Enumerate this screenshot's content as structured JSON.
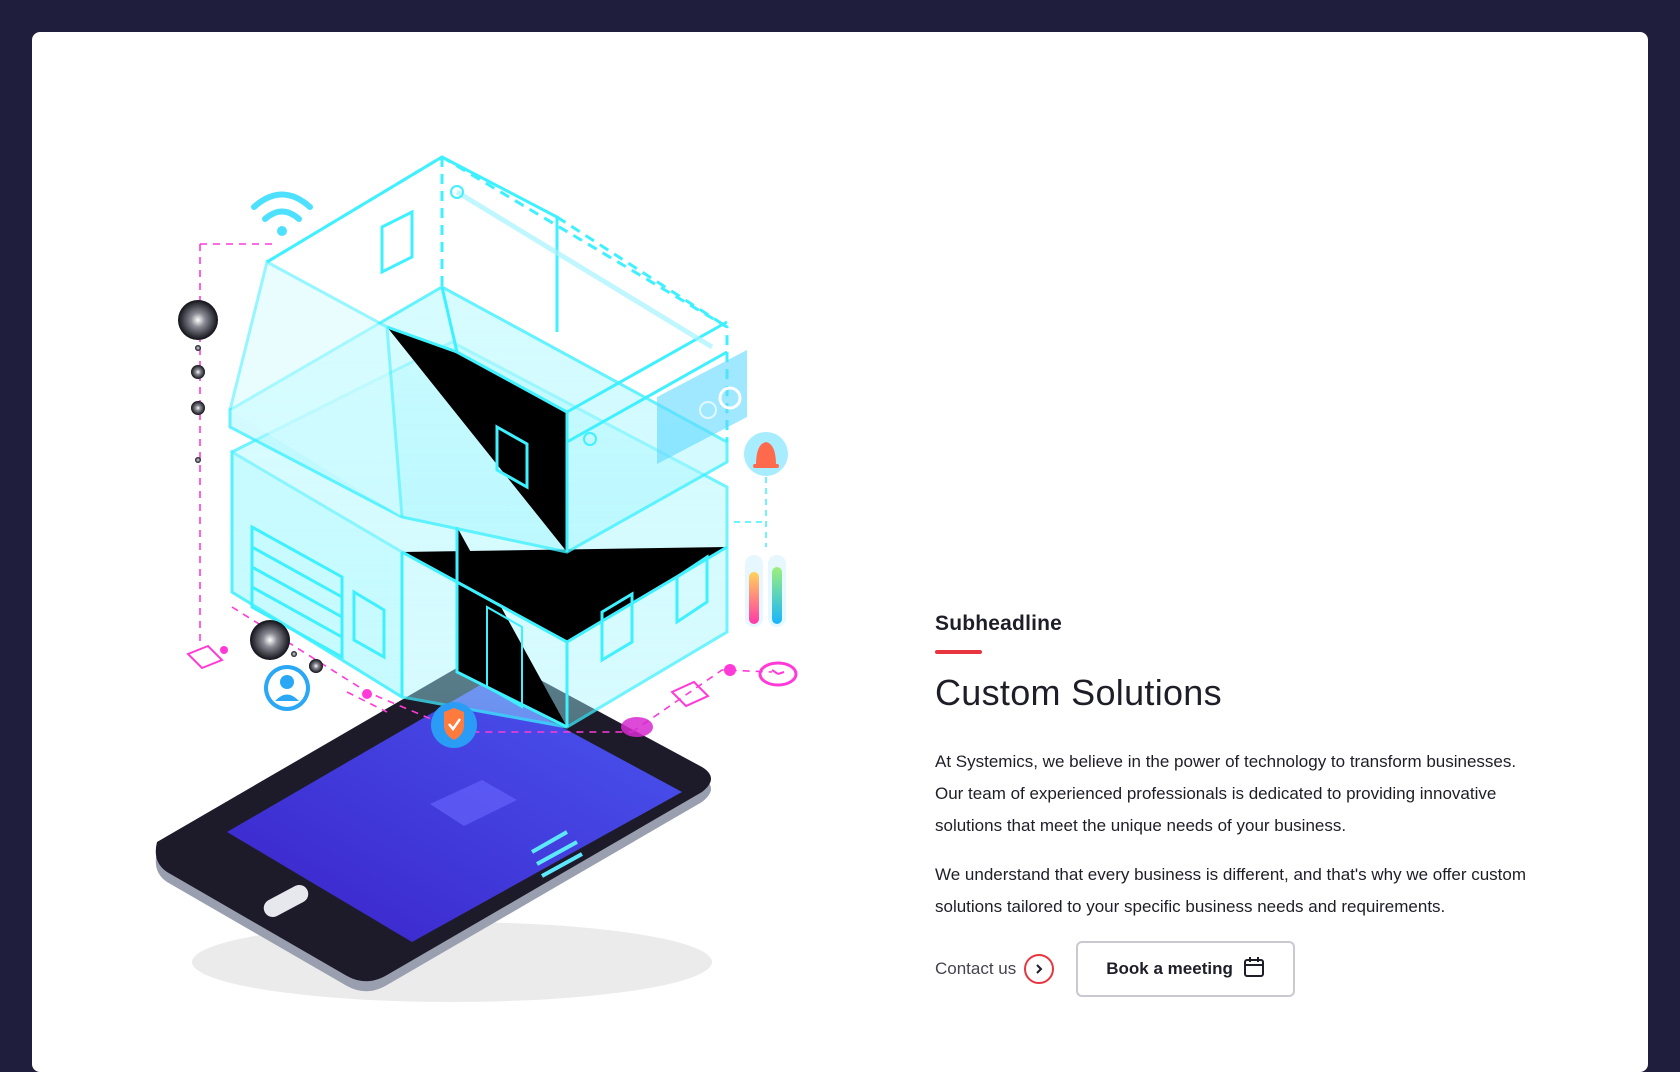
{
  "section": {
    "subheadline": "Subheadline",
    "title": "Custom Solutions",
    "paragraphs": [
      "At Systemics, we believe in the power of technology to transform businesses. Our team of experienced professionals is dedicated to providing innovative solutions that meet the unique needs of your business.",
      "We understand that every business is different, and that's why we offer custom solutions tailored to your specific business needs and requirements."
    ]
  },
  "actions": {
    "contact_label": "Contact us",
    "contact_icon": "arrow-right-circle-icon",
    "book_label": "Book a meeting",
    "book_icon": "calendar-icon"
  },
  "illustration": {
    "subject": "smart-home-on-tablet",
    "icons": [
      "wifi-icon",
      "bell-icon",
      "user-icon",
      "shield-check-icon",
      "clock-icon"
    ]
  },
  "colors": {
    "page_background": "#1f1f3d",
    "card_background": "#ffffff",
    "accent": "#e8353f",
    "text": "#1e1e28",
    "house_cyan": "#3ff0ff",
    "dashed_magenta": "#ff3ad8",
    "tablet_screen": "#3b2fd4"
  }
}
